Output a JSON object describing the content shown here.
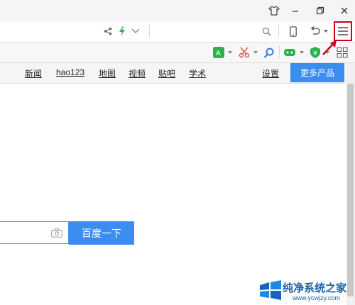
{
  "icons": {
    "shirt": "shirt-icon",
    "minimize": "minimize-icon",
    "restore": "restore-icon",
    "close": "close-icon",
    "share": "share-icon",
    "lightning": "lightning-icon",
    "dropdown": "chevron-down-icon",
    "search": "search-icon",
    "mobile": "mobile-icon",
    "undo": "undo-icon",
    "menu": "menu-icon",
    "camera": "camera-icon"
  },
  "nav": {
    "links": [
      "新闻",
      "hao123",
      "地图",
      "视频",
      "贴吧",
      "学术"
    ],
    "settings": "设置",
    "more_products": "更多产品"
  },
  "search": {
    "value": "",
    "button_label": "百度一下"
  },
  "watermark": {
    "title": "纯净系统之家",
    "url": "www.ycwjzy.com"
  },
  "colors": {
    "accent": "#3b8ef0",
    "highlight": "#d0021b"
  }
}
